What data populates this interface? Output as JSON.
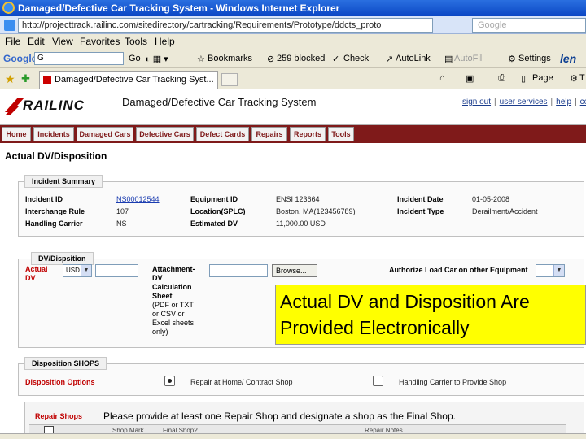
{
  "window": {
    "title": "Damaged/Defective Car Tracking System - Windows Internet Explorer",
    "url": "http://projecttrack.railinc.com/sitedirectory/cartracking/Requirements/Prototype/ddcts_proto",
    "search_placeholder": "Google"
  },
  "menu": [
    "File",
    "Edit",
    "View",
    "Favorites",
    "Tools",
    "Help"
  ],
  "google_toolbar": {
    "logo": "Google",
    "input_text": "G",
    "go": "Go",
    "bookmarks": "Bookmarks",
    "blocked": "259 blocked",
    "check": "Check",
    "autolink": "AutoLink",
    "autofill": "AutoFill",
    "settings": "Settings",
    "brand": "len"
  },
  "tab": {
    "label": "Damaged/Defective Car Tracking Syst...",
    "page_menu": "Page",
    "tools_menu": "T"
  },
  "app": {
    "logo_text": "RAILINC",
    "title": "Damaged/Defective Car Tracking System",
    "links": [
      "sign out",
      "user services",
      "help",
      "con"
    ]
  },
  "nav": [
    "Home",
    "Incidents",
    "Damaged Cars",
    "Defective Cars",
    "Defect Cards",
    "Repairs",
    "Reports",
    "Tools"
  ],
  "page_title": "Actual DV/Disposition",
  "incident_summary": {
    "heading": "Incident Summary",
    "incident_id_label": "Incident ID",
    "incident_id": "NS00012544",
    "interchange_rule_label": "Interchange Rule",
    "interchange_rule": "107",
    "handling_carrier_label": "Handling Carrier",
    "handling_carrier": "NS",
    "equipment_id_label": "Equipment ID",
    "equipment_id": "ENSI 123664",
    "location_label": "Location(SPLC)",
    "location": "Boston, MA(123456789)",
    "estimated_dv_label": "Estimated DV",
    "estimated_dv": "11,000.00 USD",
    "incident_date_label": "Incident Date",
    "incident_date": "01-05-2008",
    "incident_type_label": "Incident Type",
    "incident_type": "Derailment/Accident"
  },
  "dv_disposition": {
    "heading": "DV/Dispsition",
    "actual_dv_label_1": "Actual",
    "actual_dv_label_2": "DV",
    "currency": "USD",
    "attachment_lines": [
      "Attachment-",
      "DV",
      "Calculation",
      "Sheet",
      "(PDF or TXT",
      "or CSV or",
      "Excel sheets",
      "only)"
    ],
    "browse_label": "Browse...",
    "authorize_label": "Authorize Load Car on other Equipment"
  },
  "callout": {
    "line1": "Actual DV and Disposition Are",
    "line2": "Provided Electronically"
  },
  "disposition_shops": {
    "heading": "Disposition SHOPS",
    "options_label": "Disposition Options",
    "option1": "Repair at Home/ Contract Shop",
    "option2": "Handling Carrier to Provide Shop"
  },
  "repair_shops": {
    "label": "Repair Shops",
    "notice": "Please provide at least one Repair Shop and designate a shop as the Final Shop.",
    "columns": [
      "Shop Mark",
      "Final Shop?",
      "Repair Notes"
    ]
  }
}
